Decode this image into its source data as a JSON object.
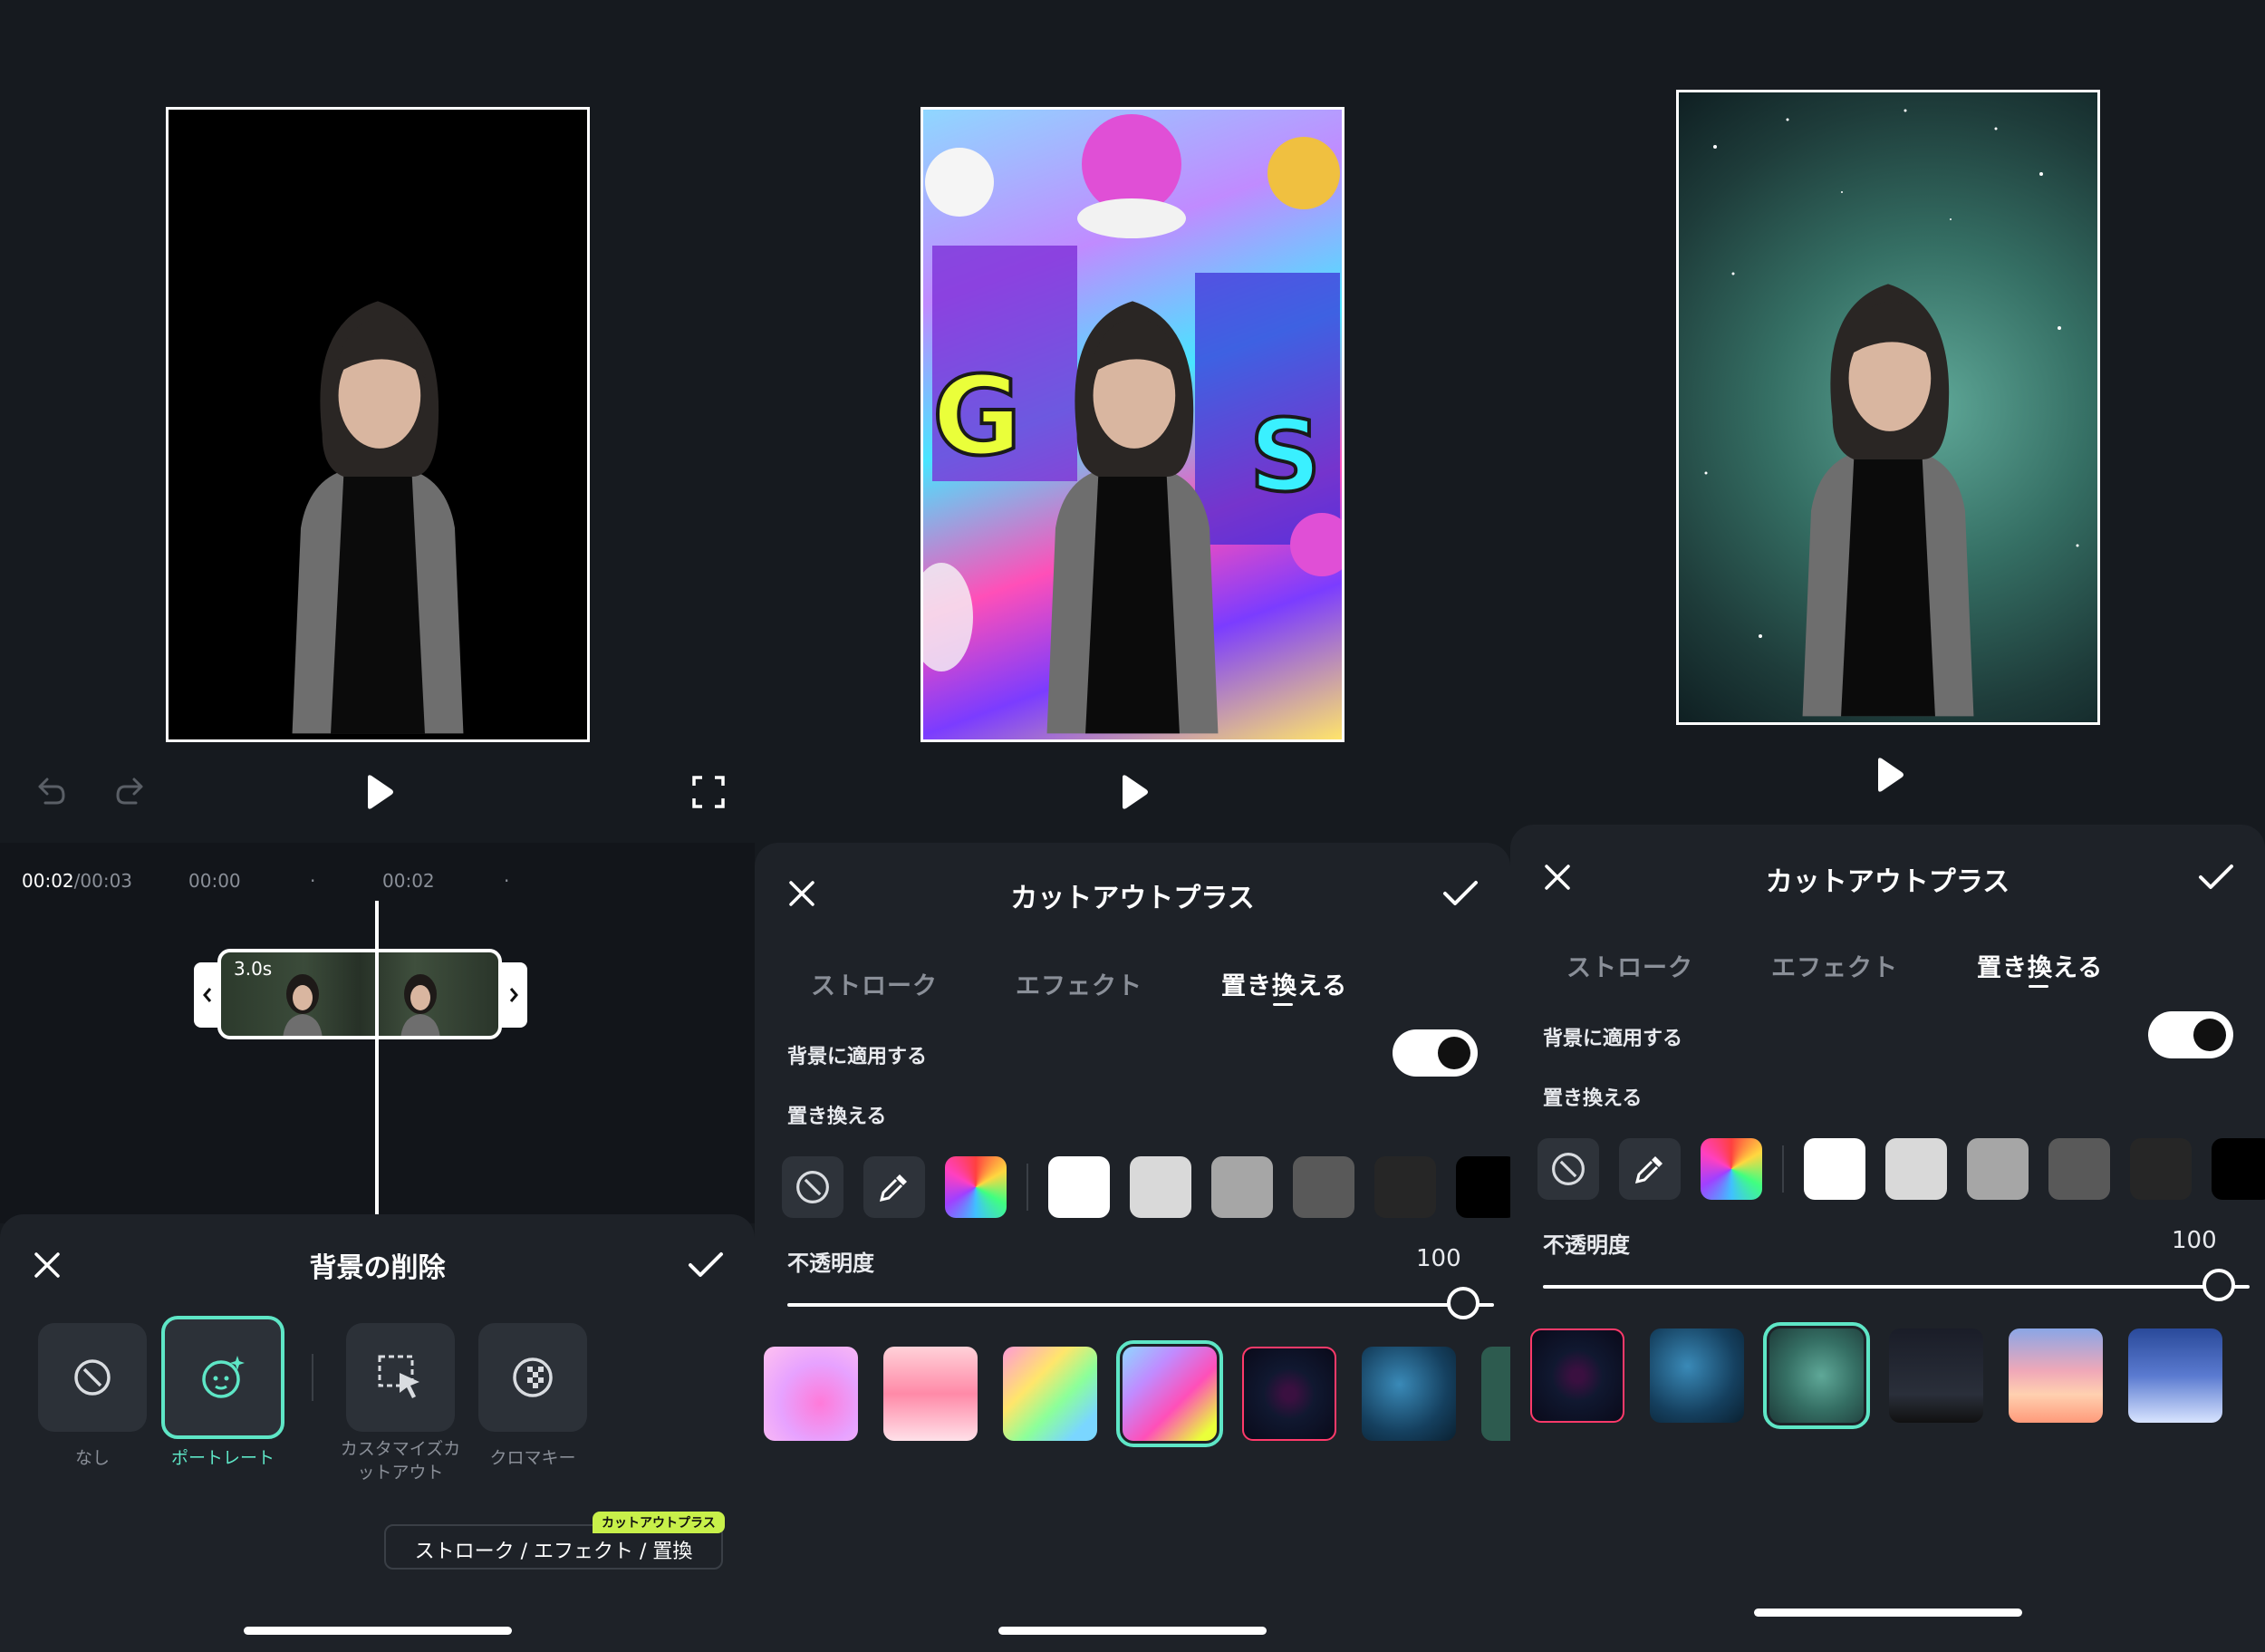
{
  "panel1": {
    "timecode_current": "00:02",
    "timecode_total": "/00:03",
    "ruler": [
      "00:00",
      "00:02"
    ],
    "clip_duration": "3.0s",
    "sheet_title": "背景の削除",
    "options": [
      {
        "label": "なし",
        "icon": "none-icon"
      },
      {
        "label": "ポートレート",
        "icon": "portrait-ai-icon"
      },
      {
        "label": "カスタマイズカ\nットアウト",
        "icon": "custom-cutout-icon"
      },
      {
        "label": "クロマキー",
        "icon": "chroma-key-icon"
      }
    ],
    "selected_option": 1,
    "plus_badge": "カットアウトプラス",
    "plus_button": "ストローク / エフェクト / 置換"
  },
  "panel2": {
    "sheet_title": "カットアウトプラス",
    "tabs": [
      "ストローク",
      "エフェクト",
      "置き換える"
    ],
    "active_tab": 2,
    "apply_bg_label": "背景に適用する",
    "replace_label": "置き換える",
    "opacity_label": "不透明度",
    "opacity_value": "100"
  },
  "panel3": {
    "sheet_title": "カットアウトプラス",
    "tabs": [
      "ストローク",
      "エフェクト",
      "置き換える"
    ],
    "active_tab": 2,
    "apply_bg_label": "背景に適用する",
    "replace_label": "置き換える",
    "opacity_label": "不透明度",
    "opacity_value": "100"
  },
  "colors": {
    "accent": "#5ee6c6",
    "badge": "#c8f04a",
    "swatches": [
      "#ffffff",
      "#d9d9d9",
      "#a6a6a6",
      "#595959",
      "#262626",
      "#000000"
    ]
  },
  "opacity_level": 1.0
}
